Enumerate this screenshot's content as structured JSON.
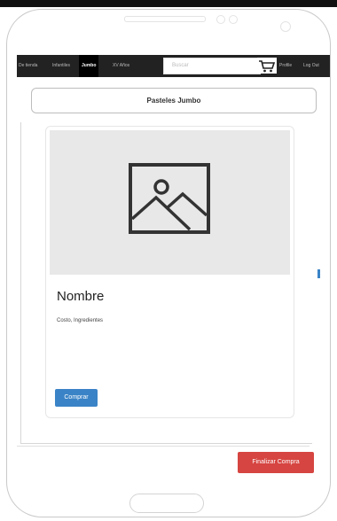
{
  "navbar": {
    "items": [
      {
        "label": "De tienda"
      },
      {
        "label": "Infantiles"
      },
      {
        "label": "Jumbo"
      },
      {
        "label": "XV Años"
      }
    ],
    "search_placeholder": "Buscar",
    "profile_label": "Profile",
    "logout_label": "Log Out"
  },
  "page": {
    "title": "Pasteles Jumbo"
  },
  "card": {
    "title": "Nombre",
    "description": "Costo, Ingredientes",
    "buy_label": "Comprar"
  },
  "footer": {
    "finish_label": "Finalizar Compra"
  },
  "colors": {
    "navbar_bg": "#222222",
    "primary": "#3a83c6",
    "danger": "#d64541"
  }
}
